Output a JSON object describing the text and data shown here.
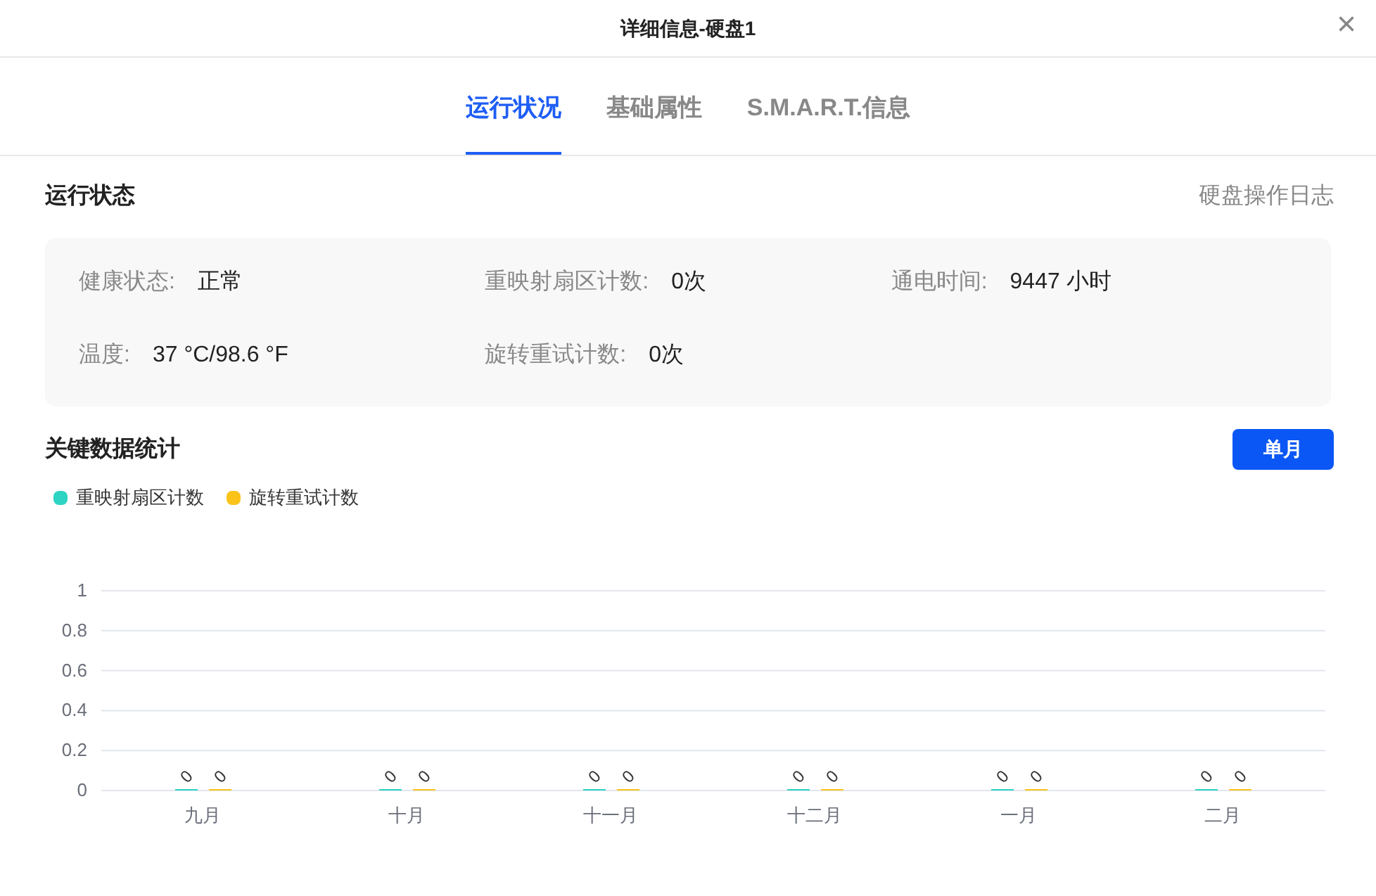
{
  "window": {
    "title": "详细信息-硬盘1",
    "close": "×"
  },
  "tabs": [
    {
      "label": "运行状况",
      "selected": true
    },
    {
      "label": "基础属性",
      "selected": false
    },
    {
      "label": "S.M.A.R.T.信息",
      "selected": false
    }
  ],
  "status_section": {
    "title": "运行状态",
    "link": "硬盘操作日志",
    "fields": [
      {
        "label": "健康状态:",
        "value": "正常"
      },
      {
        "label": "重映射扇区计数:",
        "value": "0次"
      },
      {
        "label": "通电时间:",
        "value": "9447 小时"
      },
      {
        "label": "温度:",
        "value": "37 °C/98.6 °F"
      },
      {
        "label": "旋转重试计数:",
        "value": "0次"
      }
    ]
  },
  "stats_section": {
    "title": "关键数据统计",
    "button": "单月",
    "chart_data": {
      "type": "bar",
      "categories": [
        "九月",
        "十月",
        "十一月",
        "十二月",
        "一月",
        "二月"
      ],
      "series": [
        {
          "name": "重映射扇区计数",
          "color": "#2dd4c4",
          "values": [
            0,
            0,
            0,
            0,
            0,
            0
          ]
        },
        {
          "name": "旋转重试计数",
          "color": "#fbc21a",
          "values": [
            0,
            0,
            0,
            0,
            0,
            0
          ]
        }
      ],
      "grid": true,
      "ylim": [
        0,
        1
      ],
      "yticks": [
        0,
        0.2,
        0.4,
        0.6,
        0.8,
        1
      ],
      "data_labels": true
    }
  }
}
